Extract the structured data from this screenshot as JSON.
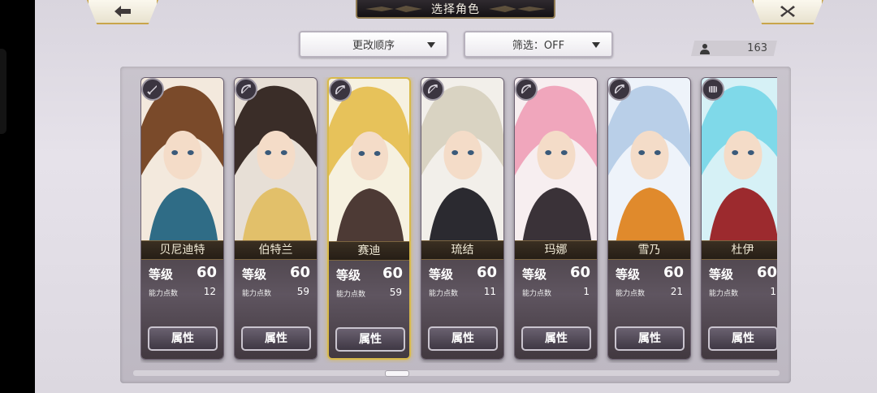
{
  "header": {
    "title": "选择角色"
  },
  "controls": {
    "sort_label": "更改顺序",
    "filter_label": "筛选：OFF",
    "character_count": "163"
  },
  "cards": [
    {
      "name": "贝尼迪特",
      "level_label": "等级",
      "level": "60",
      "points_label": "能力点数",
      "points": "12",
      "button": "属性",
      "icon": "sword-icon",
      "palette": [
        "#f3e9dd",
        "#7a4a2a",
        "#2f6c86"
      ]
    },
    {
      "name": "伯特兰",
      "level_label": "等级",
      "level": "60",
      "points_label": "能力点数",
      "points": "59",
      "button": "属性",
      "icon": "bow-icon",
      "palette": [
        "#e7dfd6",
        "#3a2d28",
        "#e2c06a"
      ]
    },
    {
      "name": "赛迪",
      "level_label": "等级",
      "level": "60",
      "points_label": "能力点数",
      "points": "59",
      "button": "属性",
      "icon": "bow-icon",
      "palette": [
        "#f6f1e0",
        "#e7c25a",
        "#4d3a35"
      ]
    },
    {
      "name": "琉结",
      "level_label": "等级",
      "level": "60",
      "points_label": "能力点数",
      "points": "11",
      "button": "属性",
      "icon": "bow-icon",
      "palette": [
        "#f2efea",
        "#d9d3c2",
        "#2b2a30"
      ]
    },
    {
      "name": "玛娜",
      "level_label": "等级",
      "level": "60",
      "points_label": "能力点数",
      "points": "1",
      "button": "属性",
      "icon": "bow-icon",
      "palette": [
        "#f7eef0",
        "#f0a6bc",
        "#3a3238"
      ]
    },
    {
      "name": "雪乃",
      "level_label": "等级",
      "level": "60",
      "points_label": "能力点数",
      "points": "21",
      "button": "属性",
      "icon": "bow-icon",
      "palette": [
        "#eef3fa",
        "#b9cfe8",
        "#e08a2c"
      ]
    },
    {
      "name": "杜伊",
      "level_label": "等级",
      "level": "60",
      "points_label": "能力点数",
      "points": "1",
      "button": "属性",
      "icon": "fist-icon",
      "palette": [
        "#d6f1f6",
        "#7fd9e9",
        "#9c2a2e"
      ]
    }
  ],
  "selected_card": 2
}
